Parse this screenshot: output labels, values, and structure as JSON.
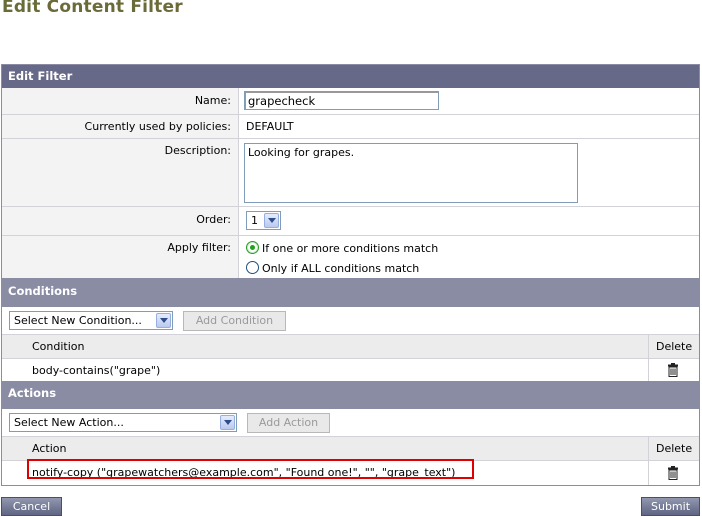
{
  "page_title": "Edit Content Filter",
  "edit_filter": {
    "section_title": "Edit Filter",
    "name_label": "Name:",
    "name_value": "grapecheck",
    "policies_label": "Currently used by policies:",
    "policies_value": "DEFAULT",
    "description_label": "Description:",
    "description_value": "Looking for grapes.",
    "order_label": "Order:",
    "order_value": "1",
    "apply_label": "Apply filter:",
    "apply_options": [
      {
        "label": "If one or more conditions match",
        "selected": true
      },
      {
        "label": "Only if ALL conditions match",
        "selected": false
      }
    ]
  },
  "conditions": {
    "section_title": "Conditions",
    "select_value": "Select New Condition...",
    "add_button": "Add Condition",
    "col_condition": "Condition",
    "col_delete": "Delete",
    "rows": [
      "body-contains(\"grape\")"
    ]
  },
  "actions": {
    "section_title": "Actions",
    "select_value": "Select New Action...",
    "add_button": "Add Action",
    "col_action": "Action",
    "col_delete": "Delete",
    "rows": [
      "notify-copy (\"grapewatchers@example.com\", \"Found one!\", \"\", \"grape_text\")"
    ]
  },
  "footer": {
    "cancel_label": "Cancel",
    "submit_label": "Submit"
  },
  "colors": {
    "section_bar": "#8a8ca4",
    "section_bar_dark": "#666a88",
    "highlight": "#e00000",
    "title": "#6b6b3a"
  },
  "icons": {
    "delete": "trash-icon",
    "dropdown": "chevron-down-icon",
    "radio": "radio-icon"
  }
}
